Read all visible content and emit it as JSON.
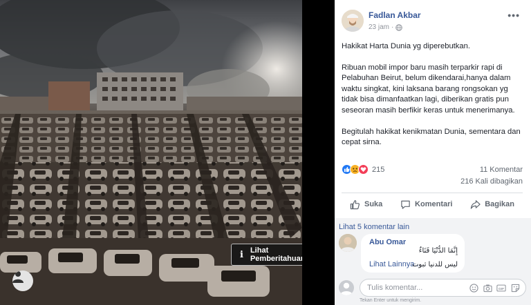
{
  "photo": {
    "notice_label": "Lihat Pemberitahuan",
    "notice_icon": "info-icon"
  },
  "post": {
    "author": "Fadlan Akbar",
    "time": "23 jam",
    "privacy_icon": "globe-icon",
    "more_icon": "more-icon",
    "more_label": "•••",
    "paragraphs": [
      "Hakikat Harta Dunia yg diperebutkan.",
      "Ribuan mobil impor baru masih terparkir rapi di Pelabuhan Beirut, belum dikendarai,hanya dalam waktu singkat, kini laksana barang rongsokan yg tidak bisa dimanfaatkan lagi, diberikan gratis pun seseoran masih berfikir keras untuk menerimanya.",
      "Begitulah hakikat kenikmatan Dunia, sementara dan cepat sirna."
    ],
    "reactions": {
      "count": "215",
      "types": [
        "like",
        "sad",
        "love"
      ],
      "colors": {
        "like": "#2078f4",
        "sad": "#f7b125",
        "love": "#f33e58"
      }
    },
    "comments_count": "11 Komentar",
    "shares_count": "216 Kali dibagikan",
    "actions": {
      "like": "Suka",
      "comment": "Komentari",
      "share": "Bagikan"
    }
  },
  "comments": {
    "more_link": "Lihat 5 komentar lain",
    "items": [
      {
        "author": "Abu Omar",
        "line1": "إِنَّمَا الدُّنْيَا فَنَاءٌ",
        "see_more": "Lihat Lainnya...",
        "line2": "ليس للدنيا ثبوت"
      }
    ],
    "write": {
      "placeholder": "Tulis komentar...",
      "hint": "Tekan Enter untuk mengirim."
    }
  },
  "colors": {
    "link": "#385898",
    "muted": "#606770",
    "text": "#1d2129",
    "panel_bg": "#ffffff",
    "comments_bg": "#f2f3f5"
  }
}
